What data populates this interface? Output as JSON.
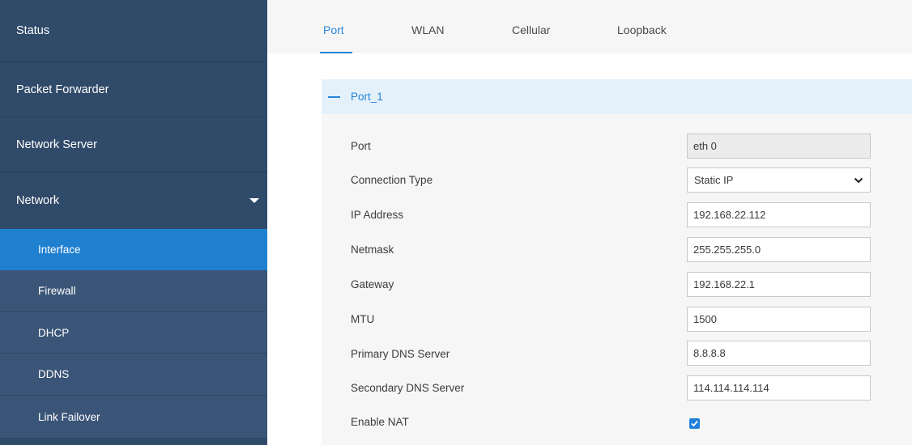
{
  "sidebar": {
    "items": [
      {
        "label": "Status"
      },
      {
        "label": "Packet Forwarder"
      },
      {
        "label": "Network Server"
      },
      {
        "label": "Network"
      }
    ],
    "network_sub": [
      {
        "label": "Interface",
        "active": true
      },
      {
        "label": "Firewall"
      },
      {
        "label": "DHCP"
      },
      {
        "label": "DDNS"
      },
      {
        "label": "Link Failover"
      }
    ]
  },
  "tabs": [
    {
      "label": "Port",
      "active": true
    },
    {
      "label": "WLAN"
    },
    {
      "label": "Cellular"
    },
    {
      "label": "Loopback"
    }
  ],
  "section": {
    "title": "Port_1"
  },
  "form": {
    "port": {
      "label": "Port",
      "value": "eth 0"
    },
    "connection_type": {
      "label": "Connection Type",
      "value": "Static IP"
    },
    "ip_address": {
      "label": "IP Address",
      "value": "192.168.22.112"
    },
    "netmask": {
      "label": "Netmask",
      "value": "255.255.255.0"
    },
    "gateway": {
      "label": "Gateway",
      "value": "192.168.22.1"
    },
    "mtu": {
      "label": "MTU",
      "value": "1500"
    },
    "primary_dns": {
      "label": "Primary DNS Server",
      "value": "8.8.8.8"
    },
    "secondary_dns": {
      "label": "Secondary DNS Server",
      "value": "114.114.114.114"
    },
    "enable_nat": {
      "label": "Enable NAT",
      "checked": true
    }
  },
  "colors": {
    "sidebar_bg": "#304a6a",
    "sidebar_sub_bg": "#3a5577",
    "active_item": "#2080d0",
    "accent": "#2784d6"
  }
}
